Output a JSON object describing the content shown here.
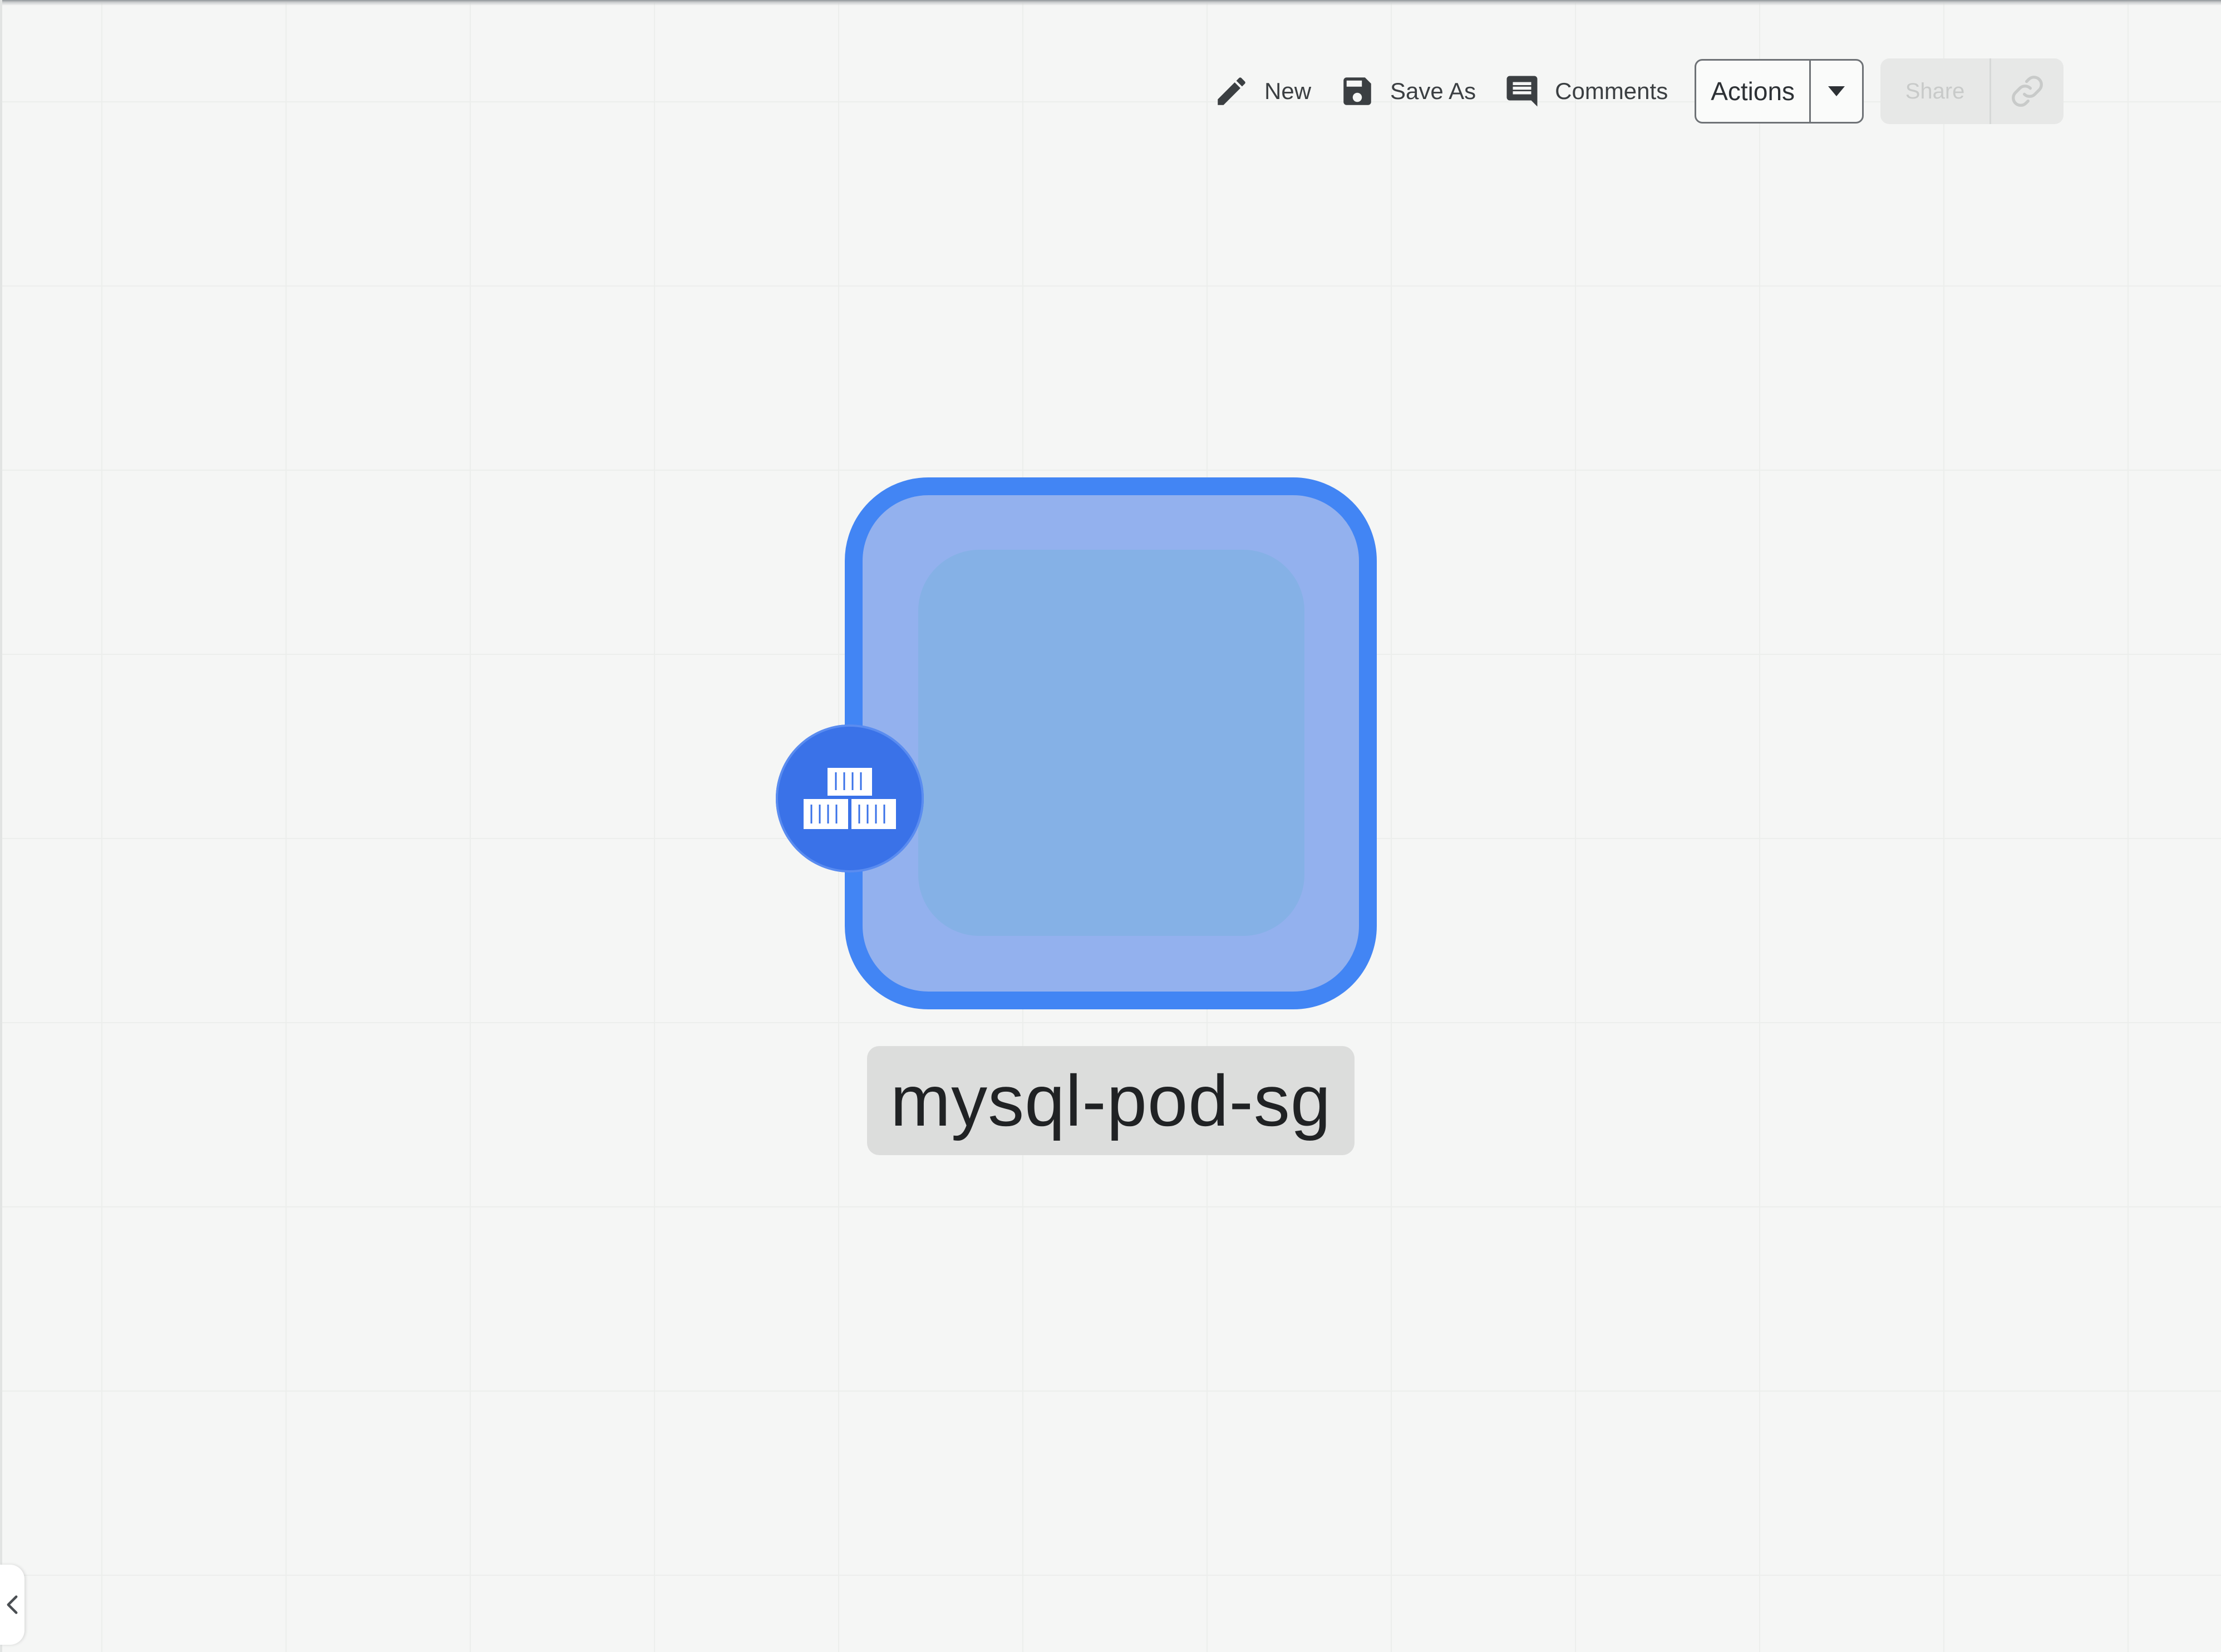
{
  "toolbar": {
    "new_label": "New",
    "new_icon": "pencil-icon",
    "save_as_label": "Save As",
    "save_as_icon": "floppy-disk-icon",
    "comments_label": "Comments",
    "comments_icon": "comment-icon",
    "actions_label": "Actions",
    "actions_icon": "caret-down-icon",
    "share_label": "Share",
    "share_link_icon": "link-icon"
  },
  "canvas": {
    "node": {
      "label": "mysql-pod-sg",
      "icon": "containers-icon"
    }
  },
  "sidebar_toggle": {
    "icon": "chevron-left-icon"
  },
  "colors": {
    "node_border": "#4285f4",
    "node_fill": "#93b1ee",
    "node_inner": "#85b1e6",
    "badge": "#3a72e8",
    "canvas_bg": "#f5f6f5"
  }
}
